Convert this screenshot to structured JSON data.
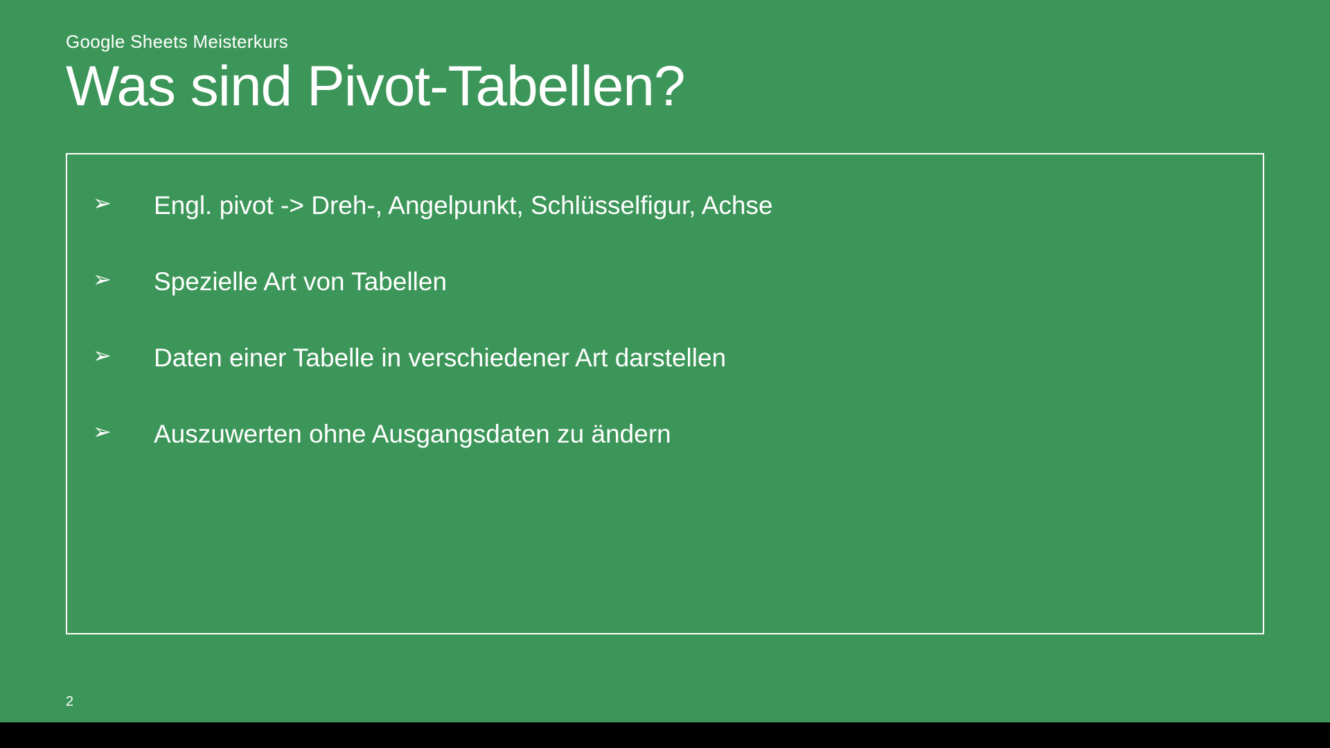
{
  "slide": {
    "subtitle": "Google Sheets Meisterkurs",
    "title": "Was sind Pivot-Tabellen?",
    "bullets": [
      "Engl. pivot -> Dreh-, Angelpunkt, Schlüsselfigur, Achse",
      "Spezielle Art von Tabellen",
      "Daten einer Tabelle in verschiedener Art darstellen",
      "Auszuwerten ohne Ausgangsdaten zu ändern"
    ],
    "page_number": "2",
    "bullet_glyph": "➢"
  }
}
